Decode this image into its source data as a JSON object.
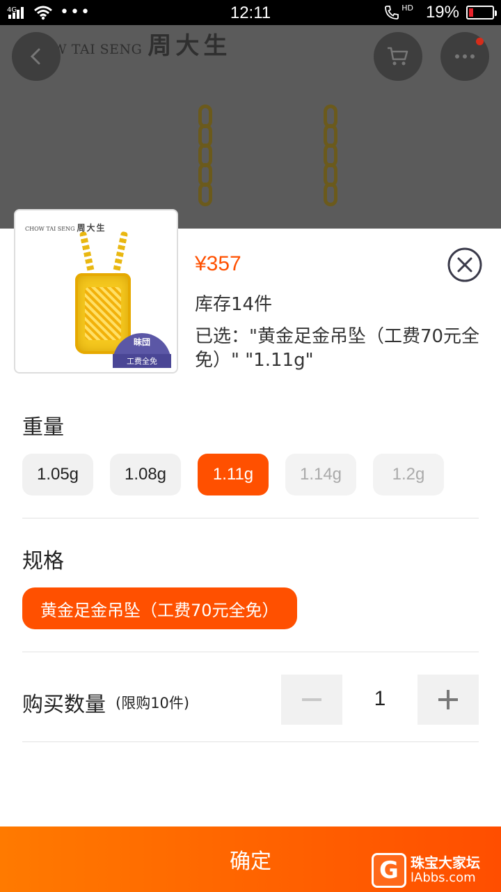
{
  "status_bar": {
    "network": "4G",
    "time": "12:11",
    "hd": "HD",
    "battery_text": "19%",
    "battery_level": 0.19,
    "icons": [
      "signal-icon",
      "wifi-icon",
      "more-dots-icon",
      "call-hd-icon",
      "battery-icon"
    ]
  },
  "backdrop": {
    "brand_en": "CHOW TAI SENG",
    "brand_cn": "周大生",
    "back_icon": "chevron-left-icon",
    "cart_icon": "cart-icon",
    "more_icon": "more-dots-icon"
  },
  "product": {
    "thumb_brand_en": "CHOW TAI SENG",
    "thumb_brand_cn": "周大生",
    "badge_top": "昧団",
    "badge_bottom": "工费全免",
    "price": "¥357",
    "stock": "库存14件",
    "selected": "已选：\"黄金足金吊坠（工费70元全免）\" \"1.11g\"",
    "close_icon": "close-circle-icon"
  },
  "weight": {
    "title": "重量",
    "options": [
      {
        "label": "1.05g",
        "state": "normal"
      },
      {
        "label": "1.08g",
        "state": "normal"
      },
      {
        "label": "1.11g",
        "state": "active"
      },
      {
        "label": "1.14g",
        "state": "disabled"
      },
      {
        "label": "1.2g",
        "state": "disabled"
      }
    ]
  },
  "spec": {
    "title": "规格",
    "option": "黄金足金吊坠（工费70元全免）"
  },
  "quantity": {
    "label": "购买数量",
    "limit": "(限购10件)",
    "value": "1",
    "minus_icon": "minus-icon",
    "plus_icon": "plus-icon"
  },
  "confirm_label": "确定",
  "watermark": {
    "logo": "G",
    "line1": "珠宝大家坛",
    "line2": "lAbbs.com"
  },
  "colors": {
    "accent": "#ff5000",
    "chip_bg": "#f1f1f1",
    "disabled_text": "#aaaaaa"
  }
}
